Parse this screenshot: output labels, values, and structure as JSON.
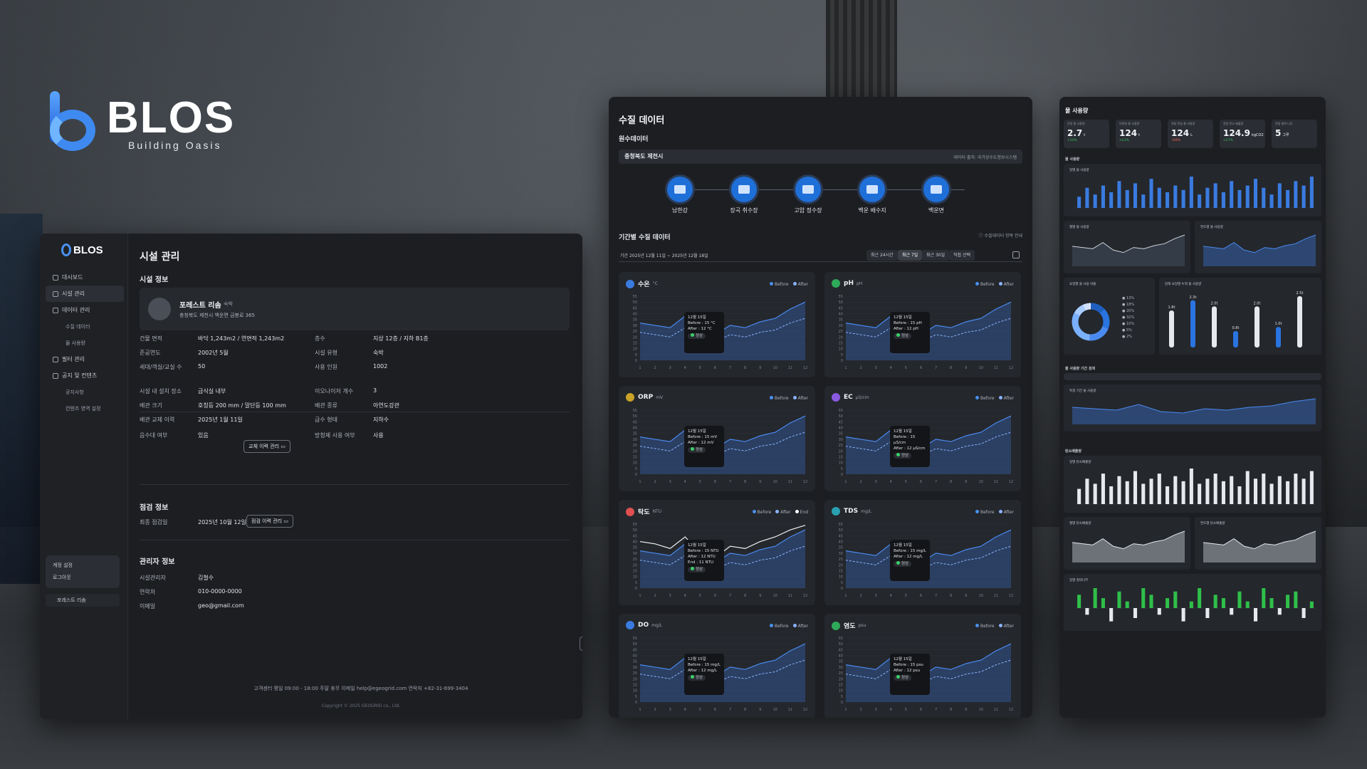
{
  "brand": {
    "name": "BLOS",
    "tagline": "Building Oasis"
  },
  "facility": {
    "logo": "BLOS",
    "nav": [
      {
        "label": "대시보드",
        "level": 0,
        "active": false
      },
      {
        "label": "시설 관리",
        "level": 0,
        "active": true
      },
      {
        "label": "데이터 관리",
        "level": 0,
        "active": false
      },
      {
        "label": "수질 데이터",
        "level": 1,
        "active": false
      },
      {
        "label": "물 사용량",
        "level": 1,
        "active": false
      },
      {
        "label": "필터 관리",
        "level": 0,
        "active": false
      },
      {
        "label": "공지 및 컨텐츠",
        "level": 0,
        "active": false
      },
      {
        "label": "공지사항",
        "level": 1,
        "active": false
      },
      {
        "label": "컨텐츠 영역 설정",
        "level": 1,
        "active": false
      }
    ],
    "account_menu": [
      "계정 설정",
      "로그아웃"
    ],
    "current_site": "포레스트 리솜",
    "page_title": "시설 관리",
    "section_info": "시설 정보",
    "site_name": "포레스트 리솜",
    "site_type": "숙박",
    "site_address": "충청북도 제천시 백운면 금봉로 365",
    "left_rows": [
      {
        "k": "건물 면적",
        "v": "바닥 1,243m2 / 연면적 1,243m2"
      },
      {
        "k": "준공연도",
        "v": "2002년 5월"
      },
      {
        "k": "세대/객실/교실 수",
        "v": "50"
      },
      {
        "k": "시설 내 설치 장소",
        "v": "급식실 내부"
      },
      {
        "k": "배관 크기",
        "v": "호칭등 200 mm / 말단등 100 mm"
      },
      {
        "k": "배관 교체 이력",
        "v": "2025년 1월 11일"
      },
      {
        "k": "음수대 여부",
        "v": "있음"
      }
    ],
    "right_rows": [
      {
        "k": "층수",
        "v": "지상 12층 / 지하 B1층"
      },
      {
        "k": "시설 유형",
        "v": "숙박"
      },
      {
        "k": "사용 인원",
        "v": "1002"
      },
      {
        "k": "이오나이저 개수",
        "v": "3"
      },
      {
        "k": "배관 종류",
        "v": "아연도강관"
      },
      {
        "k": "급수 형태",
        "v": "지하수"
      },
      {
        "k": "방청제 사용 여부",
        "v": "사용"
      }
    ],
    "pipe_history_button": "교체 이력 관리",
    "section_inspect": "점검 정보",
    "inspect_label": "최종 점검일",
    "inspect_date": "2025년 10월 12일",
    "inspect_button": "점검 이력 관리",
    "section_manager": "관리자 정보",
    "manager_rows": [
      {
        "k": "시설관리자",
        "v": "김철수"
      },
      {
        "k": "연락처",
        "v": "010-0000-0000"
      },
      {
        "k": "이메일",
        "v": "geo@gmail.com"
      }
    ],
    "edit_button": "수정",
    "footer": "고객센터  평일 09:00 - 18:00 주말 휴무    이메일  help@egeogrid.com    연락처  +82-31-699-3404",
    "copyright": "Copyright © 2025 GEOGRID co., Ltd."
  },
  "quality": {
    "title": "수질 데이터",
    "raw_label": "원수데이터",
    "region": "충청북도 제천시",
    "source_note": "데이터 출처: 국가상수도정보시스템",
    "stations": [
      "남한강",
      "장곡 취수장",
      "고암 정수장",
      "백운 배수지",
      "백운면"
    ],
    "period_title": "기간별 수질 데이터",
    "help": "수질데이터 항목 안내",
    "period_label": "기간  2025년 12월 11일 ~ 2025년 12월 18일",
    "tabs": [
      "최근 24시간",
      "최근 7일",
      "최근 30일",
      "직접 선택"
    ],
    "active_tab": 1,
    "legend_before": "Before",
    "legend_after": "After",
    "legend_end": "End",
    "tooltip_date": "12월 15일",
    "status": "정상",
    "cards": [
      {
        "name": "수온",
        "unit": "°C",
        "color": "#3a7be0",
        "before": "Before : 15 °C",
        "after": "After : 12 °C",
        "end": ""
      },
      {
        "name": "pH",
        "unit": "pH",
        "color": "#2faa5a",
        "before": "Before : 15 pH",
        "after": "After : 12 pH",
        "end": ""
      },
      {
        "name": "ORP",
        "unit": "mV",
        "color": "#c9a227",
        "before": "Before : 15 mV",
        "after": "After : 12 mV",
        "end": ""
      },
      {
        "name": "EC",
        "unit": "μS/cm",
        "color": "#8a5be0",
        "before": "Before : 15 μS/cm",
        "after": "After : 12 μS/cm",
        "end": ""
      },
      {
        "name": "탁도",
        "unit": "NTU",
        "color": "#e05050",
        "before": "Before : 15 NTU",
        "after": "After : 12 NTU",
        "end": "End : 11 NTU"
      },
      {
        "name": "TDS",
        "unit": "mg/L",
        "color": "#2aa0b0",
        "before": "Before : 15 mg/L",
        "after": "After : 12 mg/L",
        "end": ""
      },
      {
        "name": "DO",
        "unit": "mg/L",
        "color": "#3a7be0",
        "before": "Before : 15 mg/L",
        "after": "After : 12 mg/L",
        "end": ""
      },
      {
        "name": "염도",
        "unit": "psu",
        "color": "#2faa5a",
        "before": "Before : 15 psu",
        "after": "After : 12 psu",
        "end": ""
      }
    ],
    "y_ticks": [
      "55",
      "50",
      "45",
      "40",
      "35",
      "30",
      "25",
      "20",
      "15",
      "10",
      "5",
      "0"
    ],
    "x_ticks": [
      "1",
      "2",
      "3",
      "4",
      "5",
      "6",
      "7",
      "8",
      "9",
      "10",
      "11",
      "12"
    ],
    "series_before": [
      32,
      30,
      28,
      38,
      26,
      22,
      30,
      28,
      33,
      36,
      44,
      50
    ],
    "series_after": [
      24,
      22,
      20,
      28,
      18,
      16,
      22,
      20,
      24,
      26,
      32,
      36
    ],
    "series_end": [
      40,
      38,
      34,
      44,
      30,
      26,
      36,
      34,
      40,
      44,
      50,
      54
    ]
  },
  "usage": {
    "title": "물 사용량",
    "stats": [
      {
        "label": "전일 물 사용량",
        "value": "2.7",
        "unit": "t",
        "delta": "+3.6%",
        "neg": false
      },
      {
        "label": "이번달 물 사용량",
        "value": "124",
        "unit": "t",
        "delta": "+4.2%",
        "neg": false
      },
      {
        "label": "전달 전일 물 사용량",
        "value": "124",
        "unit": "L",
        "delta": "-100%",
        "neg": true
      },
      {
        "label": "전일 탄소 배출량",
        "value": "124.9",
        "unit": "kgCO2",
        "delta": "+3.7%",
        "neg": false
      },
      {
        "label": "전일 절약 나무",
        "value": "5",
        "unit": "그루",
        "delta": "",
        "neg": false
      }
    ],
    "section_usage": "물 사용량",
    "daily_title": "일별 물 사용량",
    "monthly_title": "월별 물 사용량",
    "yearly_title": "연도별 물 사용량",
    "ratio_title": "요일별 물 사용 비율",
    "weekday_title": "당해 요일별 누적 물 사용량",
    "ratio_legend": [
      "13%",
      "18%",
      "20%",
      "32%",
      "10%",
      "5%",
      "2%"
    ],
    "weekday_labels": [
      "1.8t",
      "2.3t",
      "2.0t",
      "0.8t",
      "2.0t",
      "1.0t",
      "2.5t"
    ],
    "period_section": "물 사용량 기간 검색",
    "custom_title": "특정 기간 물 사용량",
    "carbon_section": "탄소배출량",
    "carbon_daily": "일별 탄소배출량",
    "carbon_monthly": "월별 탄소배출량",
    "carbon_yearly": "연도별 탄소배출량",
    "tree_title": "일별 절약나무",
    "daily_bars": [
      5,
      9,
      6,
      10,
      7,
      12,
      8,
      11,
      6,
      13,
      9,
      7,
      10,
      8,
      14,
      6,
      9,
      11,
      7,
      12,
      8,
      10,
      13,
      9,
      6,
      11,
      8,
      12,
      10,
      14
    ],
    "carbon_bars": [
      6,
      10,
      8,
      12,
      7,
      11,
      9,
      13,
      8,
      10,
      12,
      7,
      11,
      9,
      14,
      8,
      10,
      12,
      9,
      11,
      7,
      13,
      10,
      12,
      8,
      11,
      9,
      12,
      10,
      13
    ],
    "tree_bars": [
      4,
      -2,
      6,
      3,
      -4,
      5,
      2,
      -3,
      6,
      4,
      -2,
      3,
      5,
      -4,
      2,
      6,
      -3,
      4,
      3,
      -2,
      5,
      2,
      -4,
      6,
      3,
      -2,
      4,
      5,
      -3,
      2
    ]
  }
}
